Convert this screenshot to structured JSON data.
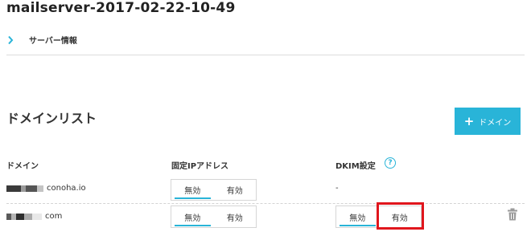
{
  "header": {
    "title": "mailserver-2017-02-22-10-49"
  },
  "breadcrumb": {
    "label": "サーバー情報",
    "icon": "chevron-right-icon"
  },
  "domain_section": {
    "title": "ドメインリスト",
    "add_button_label": "ドメイン",
    "add_button_icon": "plus-icon",
    "accent_color": "#29b4d8"
  },
  "table": {
    "columns": [
      "ドメイン",
      "固定IPアドレス",
      "DKIM設定"
    ],
    "help_icon": "?",
    "rows": [
      {
        "domain": "conoha.io",
        "fixed_ip": {
          "off_label": "無効",
          "on_label": "有効",
          "selected": "無効"
        },
        "dkim": "-"
      },
      {
        "domain": "com",
        "fixed_ip": {
          "off_label": "無効",
          "on_label": "有効",
          "selected": "無効"
        },
        "dkim": {
          "off_label": "無効",
          "on_label": "有効",
          "selected": "無効"
        }
      }
    ]
  },
  "highlight_color": "#e0161d"
}
